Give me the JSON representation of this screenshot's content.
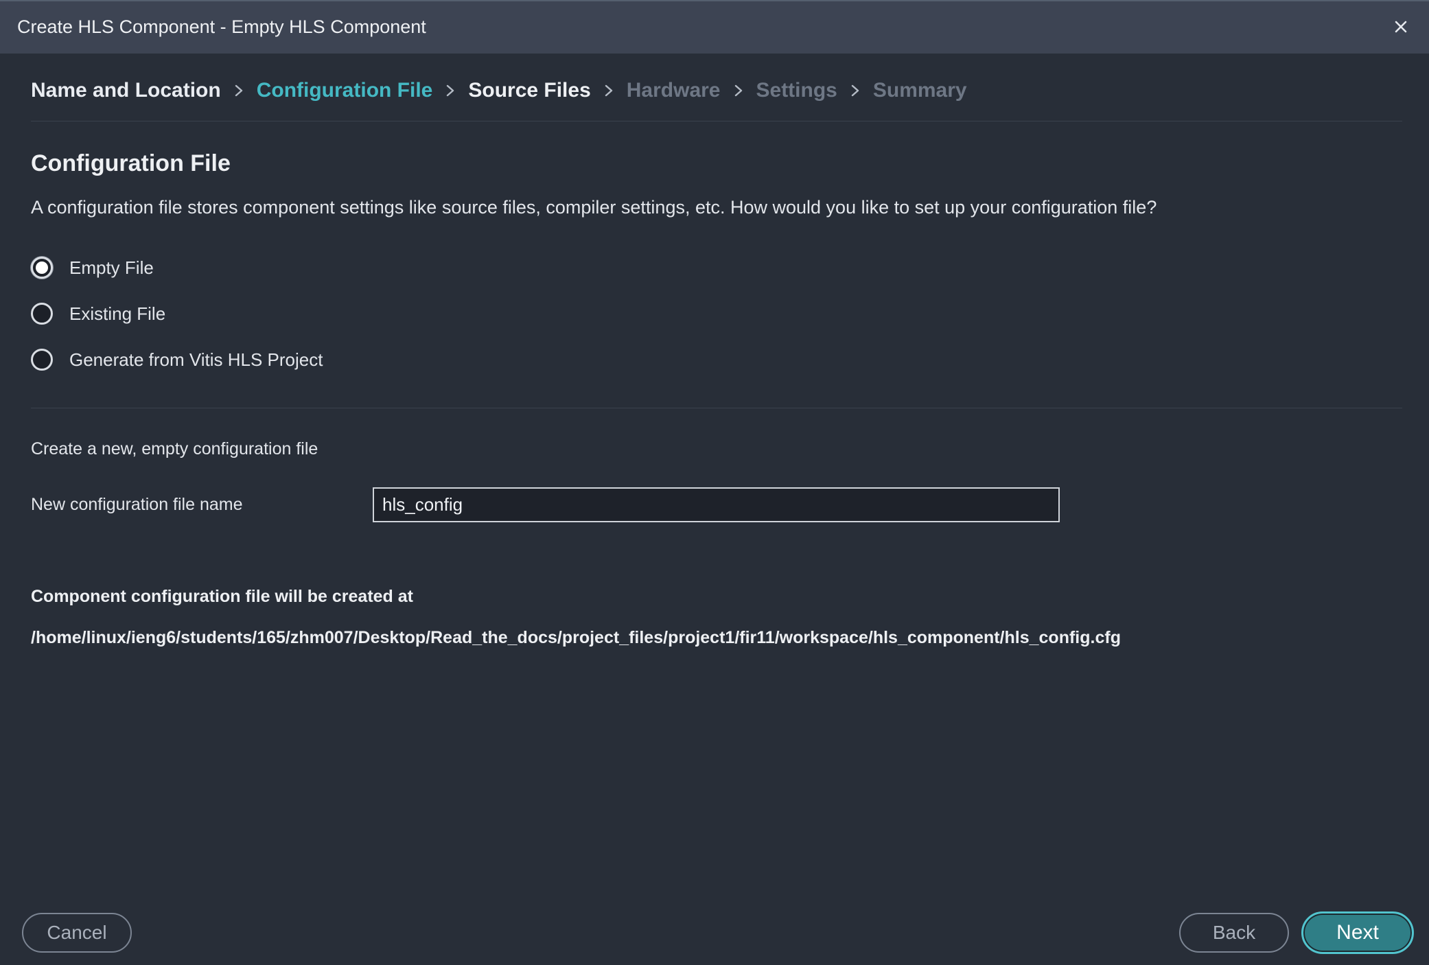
{
  "window": {
    "title": "Create HLS Component - Empty HLS Component",
    "close_icon": "close-icon"
  },
  "breadcrumb": {
    "steps": [
      {
        "label": "Name and Location",
        "state": "done"
      },
      {
        "label": "Configuration File",
        "state": "active"
      },
      {
        "label": "Source Files",
        "state": "next"
      },
      {
        "label": "Hardware",
        "state": "disabled"
      },
      {
        "label": "Settings",
        "state": "disabled"
      },
      {
        "label": "Summary",
        "state": "disabled"
      }
    ],
    "separator_icon": "chevron-right-icon"
  },
  "section": {
    "title": "Configuration File",
    "description": "A configuration file stores component settings like source files, compiler settings, etc. How would you like to set up your configuration file?"
  },
  "options": {
    "selected": "Empty File",
    "items": [
      {
        "label": "Empty File",
        "checked": true
      },
      {
        "label": "Existing File",
        "checked": false
      },
      {
        "label": "Generate from Vitis HLS Project",
        "checked": false
      }
    ]
  },
  "empty_file": {
    "description": "Create a new, empty configuration file",
    "name_label": "New configuration file name",
    "name_value": "hls_config"
  },
  "location": {
    "heading": "Component configuration file will be created at",
    "path": "/home/linux/ieng6/students/165/zhm007/Desktop/Read_the_docs/project_files/project1/fir11/workspace/hls_component/hls_config.cfg"
  },
  "buttons": {
    "cancel": "Cancel",
    "back": "Back",
    "next": "Next"
  },
  "colors": {
    "background": "#282e38",
    "titlebar": "#3d4453",
    "accent": "#45b9c4",
    "primary_button": "#2f7e86",
    "disabled_text": "#6e7785"
  }
}
